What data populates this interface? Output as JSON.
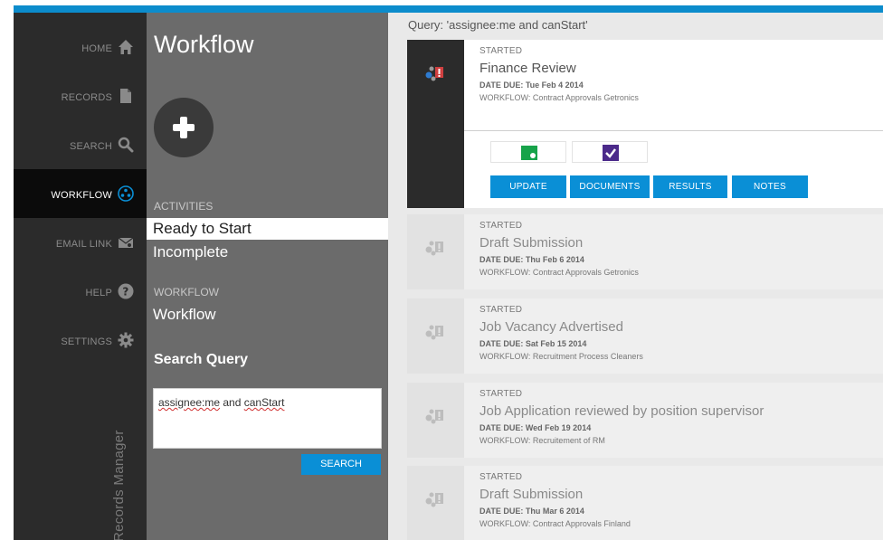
{
  "nav": {
    "items": [
      {
        "label": "HOME",
        "icon": "home-icon"
      },
      {
        "label": "RECORDS",
        "icon": "document-icon"
      },
      {
        "label": "SEARCH",
        "icon": "search-icon"
      },
      {
        "label": "WORKFLOW",
        "icon": "workflow-icon",
        "active": true
      },
      {
        "label": "EMAIL LINK",
        "icon": "email-link-icon"
      },
      {
        "label": "HELP",
        "icon": "help-icon"
      },
      {
        "label": "SETTINGS",
        "icon": "gear-icon"
      }
    ],
    "brand": "Records Manager"
  },
  "panel": {
    "title": "Workflow",
    "activities_heading": "ACTIVITIES",
    "activities": [
      "Ready to Start",
      "Incomplete"
    ],
    "workflow_heading": "WORKFLOW",
    "workflow_item": "Workflow",
    "search_query_label": "Search Query",
    "query_words": [
      "assignee:me",
      " and ",
      "canStart"
    ],
    "search_button": "SEARCH"
  },
  "content": {
    "query_text": "Query: 'assignee:me and canStart'",
    "cards": [
      {
        "status": "STARTED",
        "title": "Finance Review",
        "due": "DATE DUE: Tue Feb 4 2014",
        "workflow": "WORKFLOW: Contract Approvals Getronics",
        "expanded": true
      },
      {
        "status": "STARTED",
        "title": "Draft Submission",
        "due": "DATE DUE: Thu Feb 6 2014",
        "workflow": "WORKFLOW: Contract Approvals Getronics"
      },
      {
        "status": "STARTED",
        "title": "Job Vacancy Advertised",
        "due": "DATE DUE: Sat Feb 15 2014",
        "workflow": "WORKFLOW: Recruitment Process Cleaners"
      },
      {
        "status": "STARTED",
        "title": "Job Application reviewed by position supervisor",
        "due": "DATE DUE: Wed Feb 19 2014",
        "workflow": "WORKFLOW: Recruitement of RM"
      },
      {
        "status": "STARTED",
        "title": "Draft Submission",
        "due": "DATE DUE: Thu Mar 6 2014",
        "workflow": "WORKFLOW: Contract Approvals Finland"
      }
    ],
    "actions": [
      "UPDATE",
      "DOCUMENTS",
      "RESULTS",
      "NOTES"
    ]
  },
  "colors": {
    "accent": "#0a8fd6",
    "nav_bg": "#2b2b2b",
    "panel_bg": "#6b6b6b",
    "status_green": "#17a34a",
    "checkbox_purple": "#4b2a8a"
  }
}
